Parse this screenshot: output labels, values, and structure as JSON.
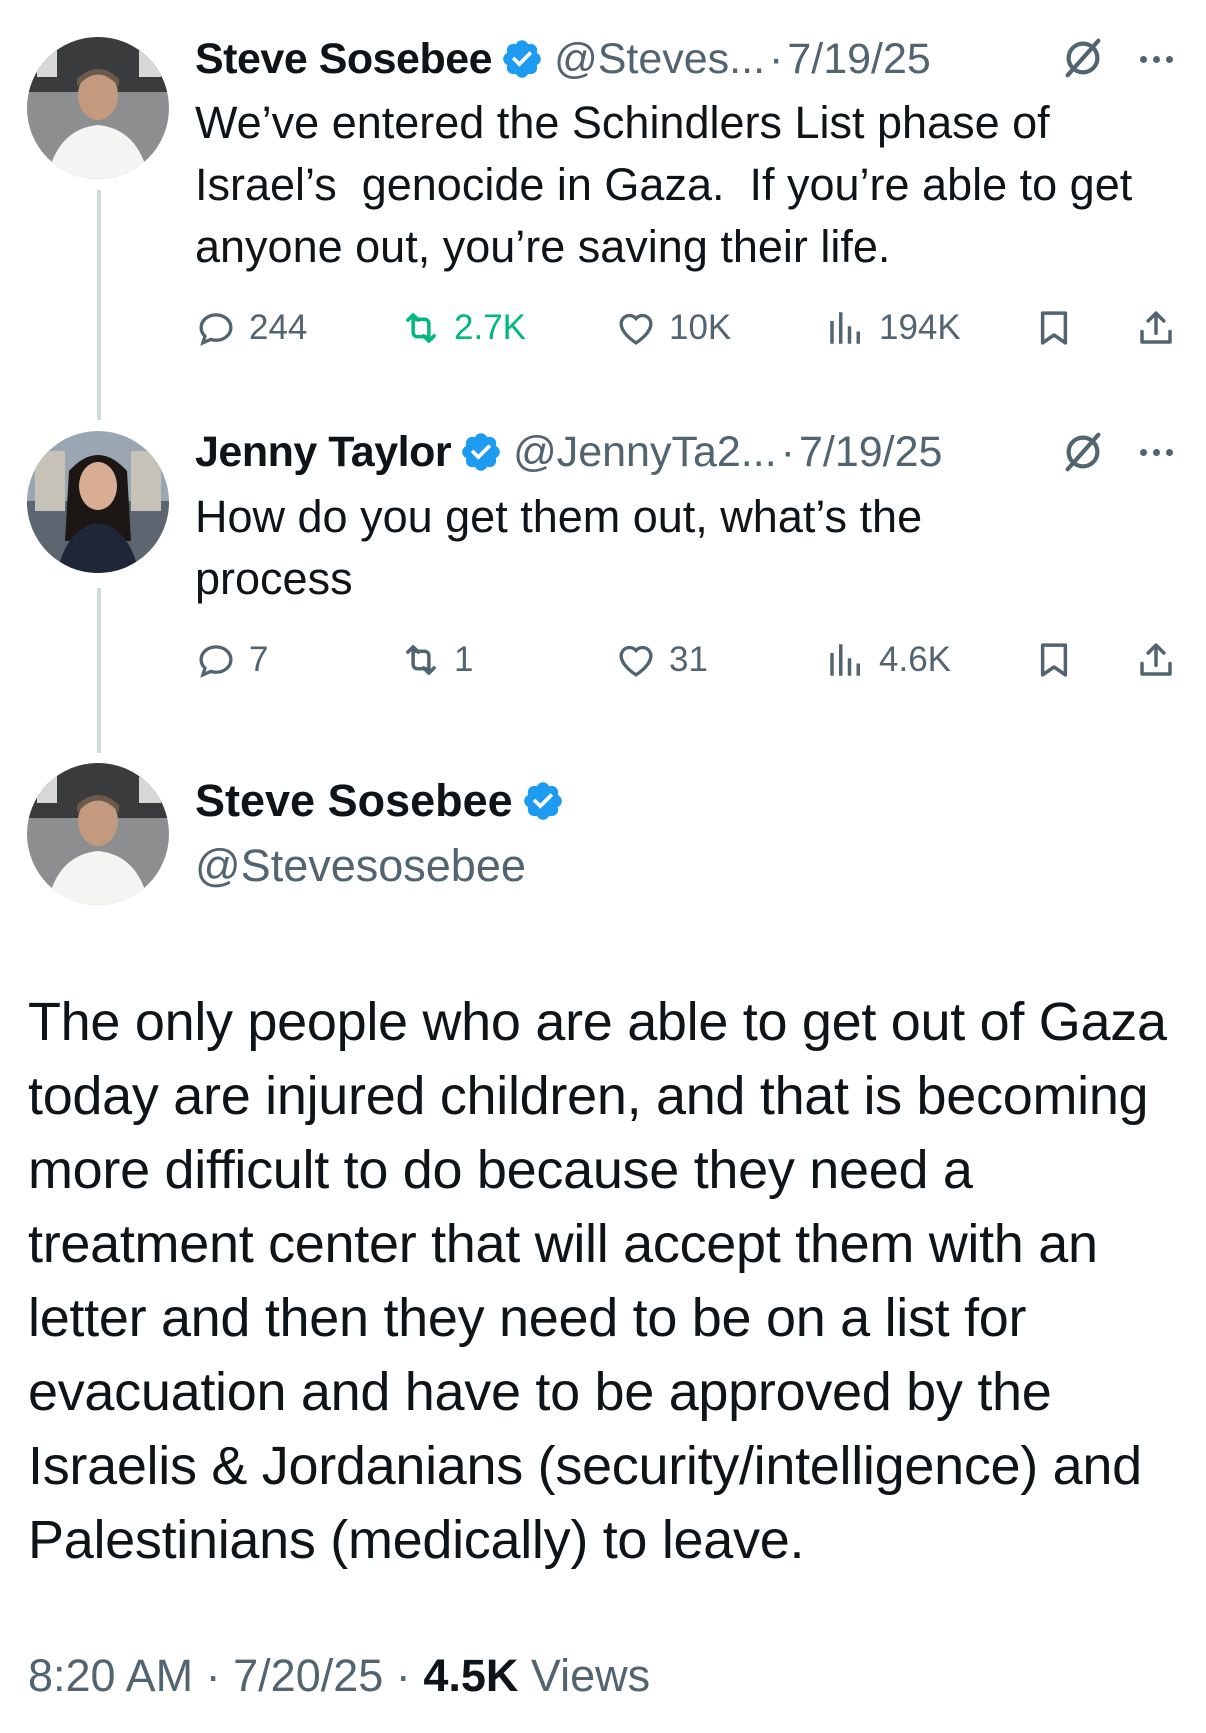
{
  "thread": [
    {
      "name": "Steve Sosebee",
      "handle": "@Steves...",
      "separator": "·",
      "date": "7/19/25",
      "text": "We’ve entered the Schindlers List phase of\nIsrael’s  genocide in Gaza.  If you’re able to get\nanyone out, you’re saving their life.",
      "stats": {
        "replies": "244",
        "reposts": "2.7K",
        "likes": "10K",
        "views": "194K"
      },
      "repost_color": "#00ba7c"
    },
    {
      "name": "Jenny Taylor",
      "handle": "@JennyTa2...",
      "separator": "·",
      "date": "7/19/25",
      "text": "How do you get them out, what’s the\nprocess",
      "stats": {
        "replies": "7",
        "reposts": "1",
        "likes": "31",
        "views": "4.6K"
      }
    }
  ],
  "main_tweet": {
    "name": "Steve Sosebee",
    "handle": "@Stevesosebee",
    "text": "The only people who are able to get out of Gaza today are injured children, and that is becoming more difficult to do because they need a treatment center that will accept them with an letter and then they need to be on a list for evacuation and have to be approved by the Israelis & Jordanians (security/intelligence) and Palestinians (medically) to leave.",
    "time": "8:20 AM",
    "separator": "·",
    "date": "7/20/25",
    "separator2": "·",
    "views_count": "4.5K",
    "views_label": "Views"
  },
  "icons": {
    "verified": "verified-badge-icon",
    "grok": "grok-icon",
    "more": "more-icon",
    "reply": "reply-icon",
    "repost": "repost-icon",
    "like": "heart-icon",
    "views": "views-icon",
    "bookmark": "bookmark-icon",
    "share": "share-icon"
  },
  "colors": {
    "verified_blue": "#1d9bf0",
    "secondary_text": "#536471",
    "repost_active": "#00ba7c",
    "thread_line": "#cfd9de"
  }
}
